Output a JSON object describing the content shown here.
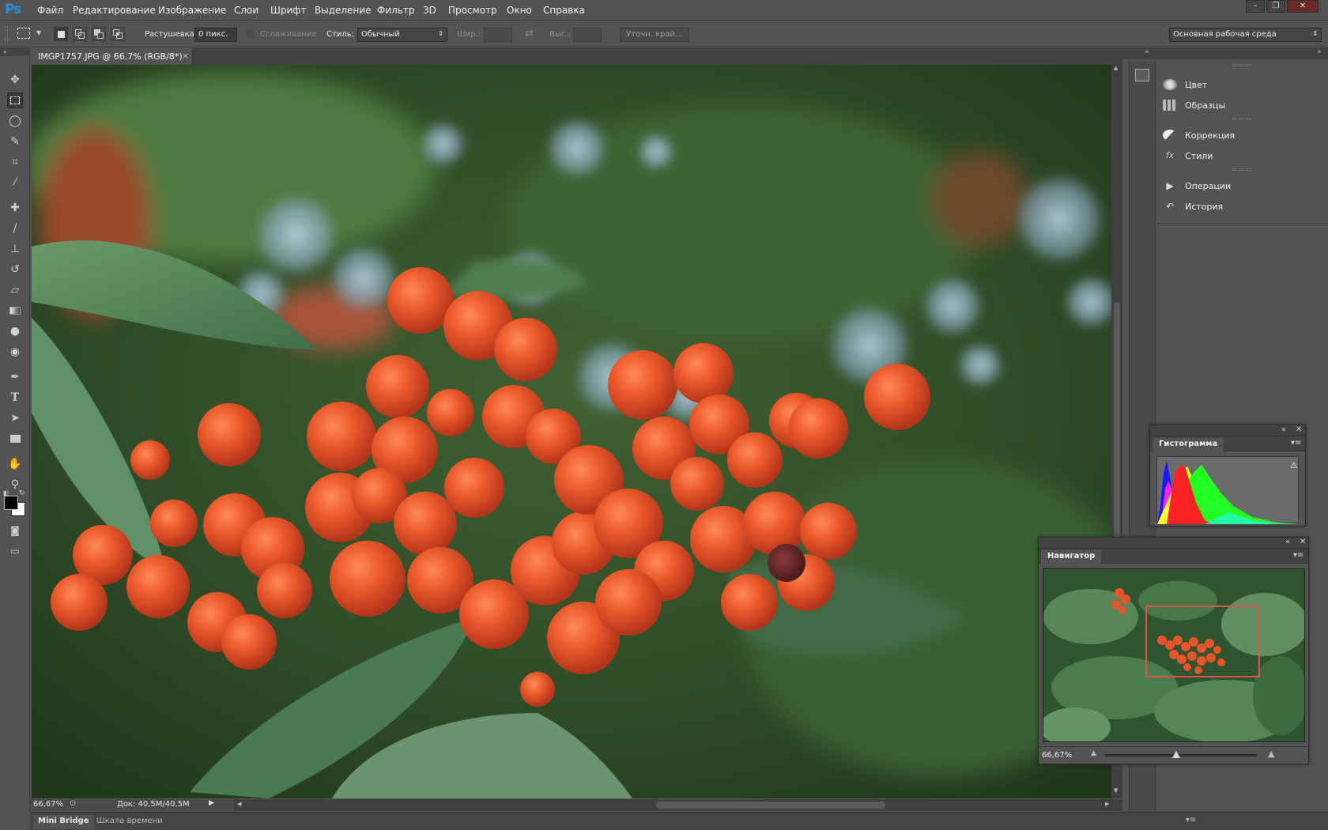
{
  "app": {
    "logo": "Ps"
  },
  "menu": [
    "Файл",
    "Редактирование",
    "Изображение",
    "Слои",
    "Шрифт",
    "Выделение",
    "Фильтр",
    "3D",
    "Просмотр",
    "Окно",
    "Справка"
  ],
  "window_controls": {
    "minimize": "–",
    "restore": "❐",
    "close": "✕"
  },
  "options_bar": {
    "feather_label": "Растушевка:",
    "feather_value": "0 пикс.",
    "antialias_label": "Сглаживание",
    "style_label": "Стиль:",
    "style_value": "Обычный",
    "width_label": "Шир.:",
    "height_label": "Выс.:",
    "refine_button": "Уточн. край...",
    "workspace": "Основная рабочая среда"
  },
  "document": {
    "tab_title": "IMGP1757.JPG @ 66,7% (RGB/8*)",
    "close": "×"
  },
  "status": {
    "zoom": "66,67%",
    "doc_info": "Док: 40,5M/40,5M"
  },
  "bottom_tabs": [
    "Mini Bridge",
    "Шкала времени"
  ],
  "right_panels": {
    "group1": [
      "Цвет",
      "Образцы"
    ],
    "group2": [
      "Коррекция",
      "Стили"
    ],
    "group3": [
      "Операции",
      "История"
    ]
  },
  "histogram": {
    "title": "Гистограмма",
    "warning": "⚠"
  },
  "navigator": {
    "title": "Навигатор",
    "zoom": "66,67%",
    "zoom_slider_fraction": 0.47
  },
  "colors": {
    "accent_ps": "#2b8ed8",
    "foreground": "#000000",
    "background": "#ffffff",
    "nav_view_box": "#e0524a"
  },
  "icons": [
    "move-icon",
    "marquee-icon",
    "lasso-icon",
    "quick-select-icon",
    "crop-icon",
    "eyedropper-icon",
    "healing-icon",
    "brush-icon",
    "stamp-icon",
    "history-brush-icon",
    "eraser-icon",
    "gradient-icon",
    "blur-icon",
    "dodge-icon",
    "pen-icon",
    "type-icon",
    "path-select-icon",
    "rectangle-icon",
    "hand-icon",
    "zoom-icon"
  ]
}
